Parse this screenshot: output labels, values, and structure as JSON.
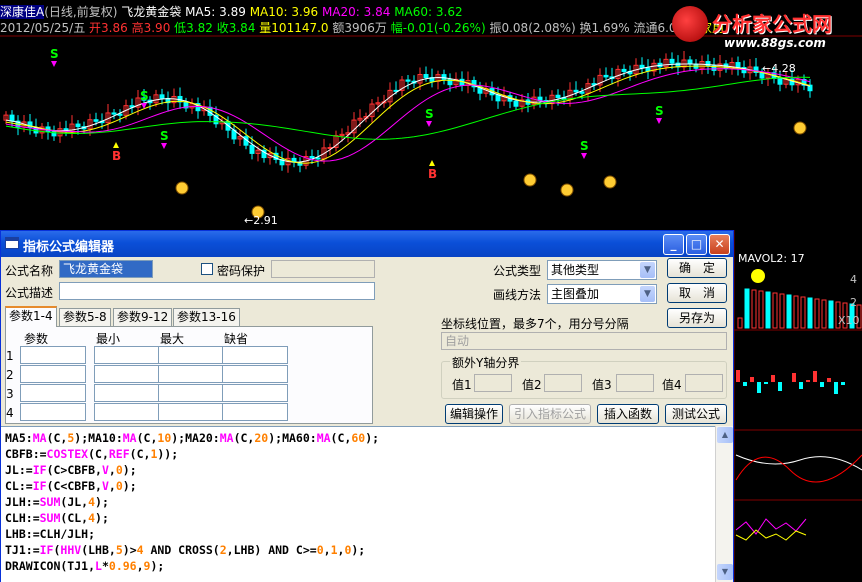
{
  "chart_header": {
    "line1": {
      "stock": "深康佳A",
      "period": "(日线,前复权)",
      "indicator": "飞龙黄金袋",
      "ma5": "MA5: 3.89",
      "ma10": "MA10: 3.96",
      "ma20": "MA20: 3.84",
      "ma60": "MA60: 3.62"
    },
    "line2": {
      "date": "2012/05/25/五",
      "open": "开3.86",
      "high": "高3.90",
      "low": "低3.82",
      "close": "收3.84",
      "vol": "量101147.0",
      "amt": "额3906万",
      "change": "幅-0.01(-0.26%)",
      "amp": "振0.08(2.08%)",
      "turnover": "换1.69%",
      "float": "流通6.00亿",
      "flag": "家用"
    },
    "price_high_label": "4.28",
    "price_low_label": "2.91",
    "signal_s": "S",
    "signal_b": "B"
  },
  "watermark": {
    "title": "分析家公式网",
    "url": "www.88gs.com"
  },
  "side_panel": {
    "mavol_label": "MAVOL2: 17",
    "tick_4": "4",
    "tick_2": "2",
    "tick_x10": "X10"
  },
  "dialog": {
    "title": "指标公式编辑器",
    "buttons": {
      "minimize": "_",
      "maximize": "□",
      "close": "✕"
    },
    "name_label": "公式名称",
    "name_value": "飞龙黄金袋",
    "password_label": "密码保护",
    "desc_label": "公式描述",
    "desc_value": "",
    "type_label": "公式类型",
    "type_value": "其他类型",
    "draw_label": "画线方法",
    "draw_value": "主图叠加",
    "ok": "确　定",
    "cancel": "取　消",
    "save_as": "另存为",
    "tabs": [
      "参数1-4",
      "参数5-8",
      "参数9-12",
      "参数13-16"
    ],
    "param_headers": [
      "参数",
      "最小",
      "最大",
      "缺省"
    ],
    "param_rows": [
      "1",
      "2",
      "3",
      "4"
    ],
    "axis_label": "坐标线位置，最多7个，用分号分隔",
    "axis_value": "自动",
    "extra_axis_title": "额外Y轴分界",
    "value_labels": [
      "值1",
      "值2",
      "值3",
      "值4"
    ],
    "edit_btn": "编辑操作",
    "import_btn": "引入指标公式",
    "insert_btn": "插入函数",
    "test_btn": "测试公式"
  },
  "code_lines": [
    [
      [
        "MA5:",
        ""
      ],
      [
        "MA",
        "f"
      ],
      [
        "(C,",
        ""
      ],
      [
        "5",
        "n"
      ],
      [
        ");MA10:",
        ""
      ],
      [
        "MA",
        "f"
      ],
      [
        "(C,",
        ""
      ],
      [
        "10",
        "n"
      ],
      [
        ");MA20:",
        ""
      ],
      [
        "MA",
        "f"
      ],
      [
        "(C,",
        ""
      ],
      [
        "20",
        "n"
      ],
      [
        ");MA60:",
        ""
      ],
      [
        "MA",
        "f"
      ],
      [
        "(C,",
        ""
      ],
      [
        "60",
        "n"
      ],
      [
        ");",
        ""
      ]
    ],
    [
      [
        "CBFB:=",
        ""
      ],
      [
        "COSTEX",
        "f"
      ],
      [
        "(C,",
        ""
      ],
      [
        "REF",
        "f"
      ],
      [
        "(C,",
        ""
      ],
      [
        "1",
        "n"
      ],
      [
        "));",
        ""
      ]
    ],
    [
      [
        "JL:=",
        ""
      ],
      [
        "IF",
        "f"
      ],
      [
        "(C>CBFB,",
        ""
      ],
      [
        "V",
        "f"
      ],
      [
        ",",
        ""
      ],
      [
        "0",
        "n"
      ],
      [
        ");",
        ""
      ]
    ],
    [
      [
        "CL:=",
        ""
      ],
      [
        "IF",
        "f"
      ],
      [
        "(C<CBFB,",
        ""
      ],
      [
        "V",
        "f"
      ],
      [
        ",",
        ""
      ],
      [
        "0",
        "n"
      ],
      [
        ");",
        ""
      ]
    ],
    [
      [
        "JLH:=",
        ""
      ],
      [
        "SUM",
        "f"
      ],
      [
        "(JL,",
        ""
      ],
      [
        "4",
        "n"
      ],
      [
        ");",
        ""
      ]
    ],
    [
      [
        "CLH:=",
        ""
      ],
      [
        "SUM",
        "f"
      ],
      [
        "(CL,",
        ""
      ],
      [
        "4",
        "n"
      ],
      [
        ");",
        ""
      ]
    ],
    [
      [
        "LHB:=CLH/JLH;",
        ""
      ]
    ],
    [
      [
        "TJ1:=",
        ""
      ],
      [
        "IF",
        "f"
      ],
      [
        "(",
        ""
      ],
      [
        "HHV",
        "f"
      ],
      [
        "(LHB,",
        ""
      ],
      [
        "5",
        "n"
      ],
      [
        ")>",
        ""
      ],
      [
        "4",
        "n"
      ],
      [
        " AND CROSS(",
        ""
      ],
      [
        "2",
        "n"
      ],
      [
        ",LHB) AND C>=",
        ""
      ],
      [
        "0",
        "n"
      ],
      [
        ",",
        ""
      ],
      [
        "1",
        "n"
      ],
      [
        ",",
        ""
      ],
      [
        "0",
        "n"
      ],
      [
        ");",
        ""
      ]
    ],
    [
      [
        "DRAWICON(TJ1,",
        ""
      ],
      [
        "L",
        "f"
      ],
      [
        "*",
        ""
      ],
      [
        "0.96",
        "n"
      ],
      [
        ",",
        ""
      ],
      [
        "9",
        "n"
      ],
      [
        ");",
        ""
      ]
    ]
  ],
  "colors": {
    "up": "#ff3232",
    "down": "#00ffff",
    "ma5": "#ffffff",
    "ma10": "#ffff00",
    "ma20": "#ff00ff",
    "ma60": "#00ff00",
    "signal_s": "#00ff00",
    "signal_b": "#ff3232"
  }
}
